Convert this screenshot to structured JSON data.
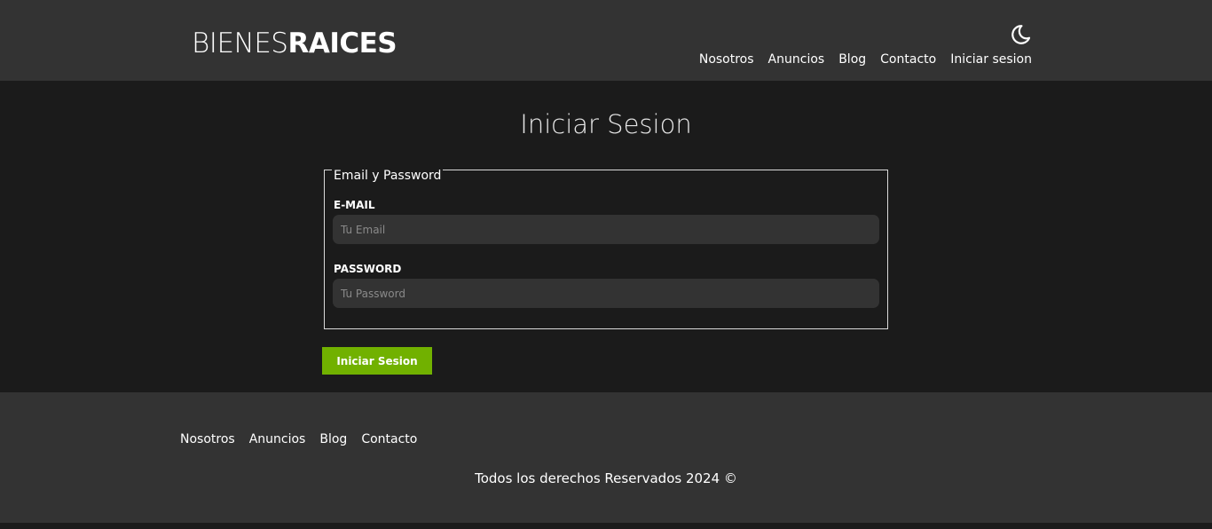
{
  "header": {
    "logo_light": "BIENES",
    "logo_bold": "RAICES",
    "dark_mode_icon": "moon-icon",
    "nav": [
      "Nosotros",
      "Anuncios",
      "Blog",
      "Contacto",
      "Iniciar sesion"
    ]
  },
  "main": {
    "title": "Iniciar Sesion",
    "fieldset_legend": "Email y Password",
    "email_label": "E-MAIL",
    "email_placeholder": "Tu Email",
    "email_value": "",
    "password_label": "PASSWORD",
    "password_placeholder": "Tu Password",
    "password_value": "",
    "submit_label": "Iniciar Sesion"
  },
  "footer": {
    "nav": [
      "Nosotros",
      "Anuncios",
      "Blog",
      "Contacto"
    ],
    "copyright": "Todos los derechos Reservados 2024 ©"
  },
  "colors": {
    "header_bg": "#333333",
    "body_bg": "#1b1b1b",
    "accent": "#71b100",
    "input_bg": "#333333"
  }
}
